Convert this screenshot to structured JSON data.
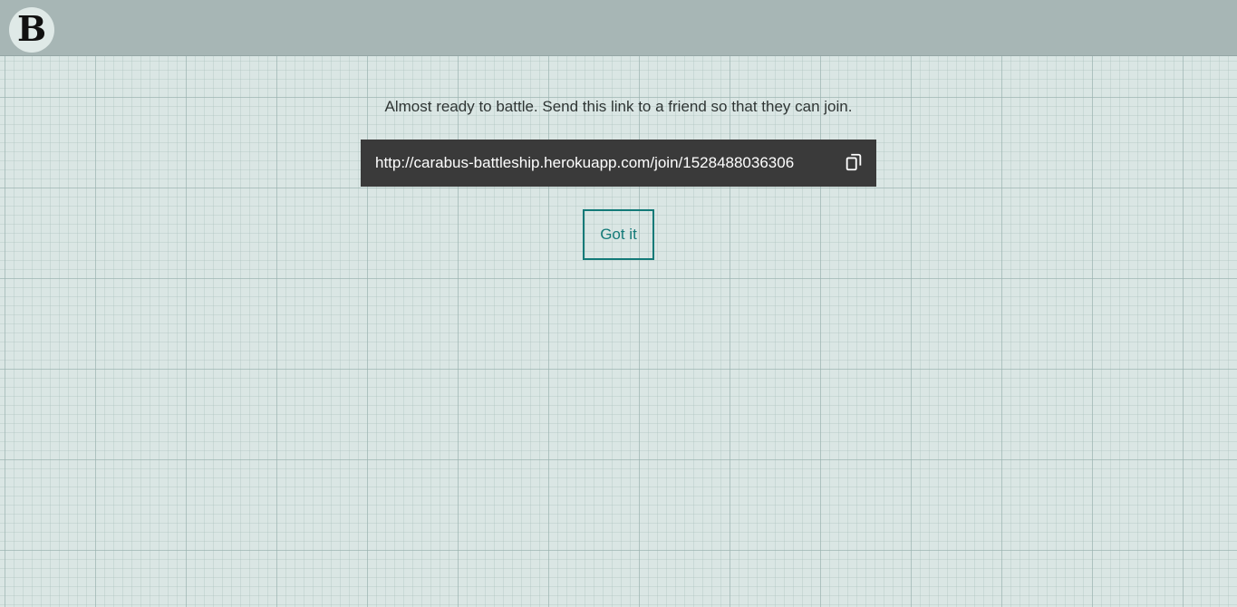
{
  "header": {
    "logo_text": "B",
    "logo_icon": "battleship-b-logo-icon"
  },
  "main": {
    "message": "Almost ready to battle. Send this link to a friend so that they can join.",
    "invite_link": "http://carabus-battleship.herokuapp.com/join/1528488036306",
    "copy_icon": "copy-to-clipboard-icon",
    "confirm_label": "Got it"
  },
  "colors": {
    "background": "#dae6e4",
    "header": "#a7b6b5",
    "link_box": "#3a3a3a",
    "accent": "#137a78"
  }
}
